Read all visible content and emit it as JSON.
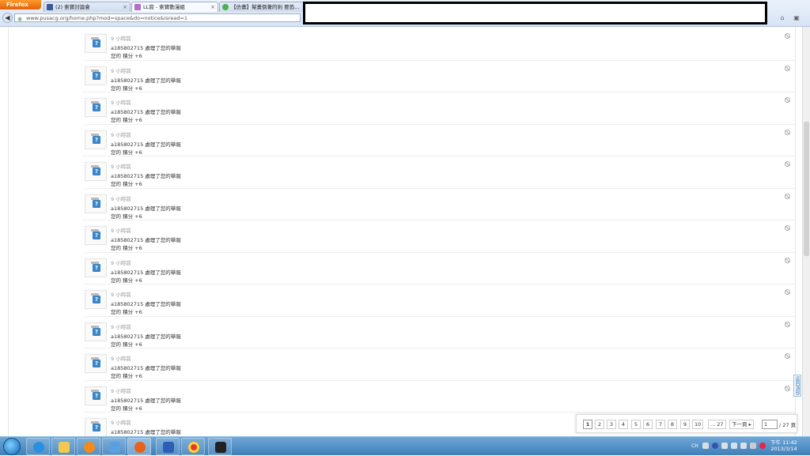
{
  "browser": {
    "firefox_label": "Firefox",
    "tabs": [
      {
        "title": "(2) 索寶討論會",
        "active": false
      },
      {
        "title": "LL窩 - 索寶動漫組",
        "active": true
      },
      {
        "title": "【仿畫】幫畫倒著的劍 要恐...",
        "active": false
      }
    ],
    "url": "www.pusacg.org/home.php?mod=space&do=notice&isread=1"
  },
  "notices": [
    {
      "time": "9 小時前",
      "text": "a185802715 處理了您的舉報",
      "points": "您的 積分 +6"
    },
    {
      "time": "9 小時前",
      "text": "a185802715 處理了您的舉報",
      "points": "您的 積分 +6"
    },
    {
      "time": "9 小時前",
      "text": "a185802715 處理了您的舉報",
      "points": "您的 積分 +6"
    },
    {
      "time": "9 小時前",
      "text": "a185802715 處理了您的舉報",
      "points": "您的 積分 +6"
    },
    {
      "time": "9 小時前",
      "text": "a185802715 處理了您的舉報",
      "points": "您的 積分 +6"
    },
    {
      "time": "9 小時前",
      "text": "a185802715 處理了您的舉報",
      "points": "您的 積分 +6"
    },
    {
      "time": "9 小時前",
      "text": "a185802715 處理了您的舉報",
      "points": "您的 積分 +6"
    },
    {
      "time": "9 小時前",
      "text": "a185802715 處理了您的舉報",
      "points": "您的 積分 +6"
    },
    {
      "time": "9 小時前",
      "text": "a185802715 處理了您的舉報",
      "points": "您的 積分 +6"
    },
    {
      "time": "9 小時前",
      "text": "a185802715 處理了您的舉報",
      "points": "您的 積分 +6"
    },
    {
      "time": "9 小時前",
      "text": "a185802715 處理了您的舉報",
      "points": "您的 積分 +6"
    },
    {
      "time": "9 小時前",
      "text": "a185802715 處理了您的舉報",
      "points": "您的 積分 +6"
    },
    {
      "time": "9 小時前",
      "text": "a185802715 處理了您的舉報",
      "points": "您的 積分 +6"
    }
  ],
  "pager": {
    "pages": [
      "1",
      "2",
      "3",
      "4",
      "5",
      "6",
      "7",
      "8",
      "9",
      "10",
      "... 27"
    ],
    "next_label": "下一頁 ▸",
    "current_input": "1",
    "total_label": "/ 27 頁"
  },
  "back_to_top": "返回頂部",
  "taskbar": {
    "apps": [
      "ie-icon",
      "explorer-icon",
      "media-player-icon",
      "network-icon",
      "firefox-icon",
      "word-icon",
      "chrome-icon",
      "phone-icon"
    ],
    "lang": "CH",
    "clock_time": "下午 11:42",
    "clock_date": "2013/3/14"
  },
  "colors": {
    "taskbar": "#3f7fba",
    "accent": "#3a86c8"
  }
}
